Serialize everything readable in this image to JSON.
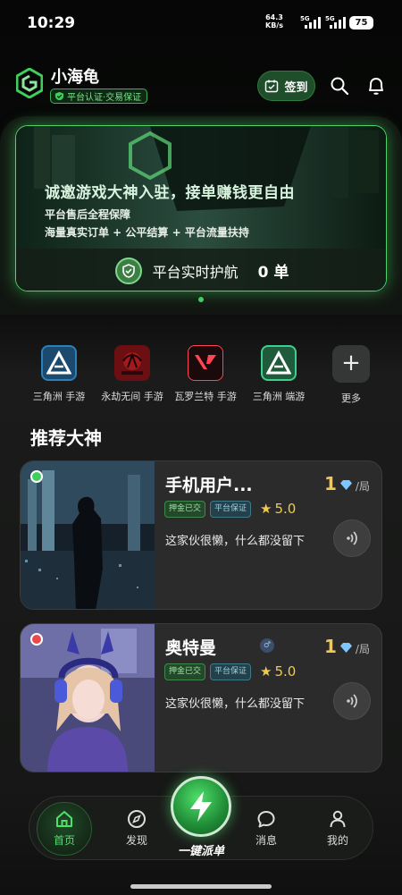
{
  "status_bar": {
    "time": "10:29",
    "net_speed": "64.3",
    "net_unit": "KB/s",
    "sig1": "5G",
    "sig2": "5G",
    "battery": "75"
  },
  "header": {
    "app_name": "小海龟",
    "cert_badge": "平台认证·交易保证",
    "checkin_label": "签到"
  },
  "banner": {
    "title": "诚邀游戏大神入驻，接单赚钱更自由",
    "sub1": "平台售后全程保障",
    "sub2": "海量真实订单 + 公平结算 + 平台流量扶持",
    "escort_label": "平台实时护航",
    "escort_count": "0 单"
  },
  "colors": {
    "accent": "#3fcf5c",
    "gold": "#f2c94c",
    "online": "#3fcf5c",
    "busy": "#e84a4a"
  },
  "games": [
    {
      "label": "三角洲 手游",
      "icon": "delta-icon"
    },
    {
      "label": "永劫无间 手游",
      "icon": "naraka-icon"
    },
    {
      "label": "瓦罗兰特 手游",
      "icon": "valorant-icon"
    },
    {
      "label": "三角洲 端游",
      "icon": "delta-pc-icon"
    },
    {
      "label": "更多",
      "icon": "plus-icon"
    }
  ],
  "section": {
    "title": "推荐大神"
  },
  "players": [
    {
      "name": "手机用户...",
      "price": "1",
      "unit": "/局",
      "tag_deposit": "押金已交",
      "tag_guarantee": "平台保证",
      "rating": "5.0",
      "bio": "这家伙很懒，什么都没留下",
      "status": "online"
    },
    {
      "name": "奥特曼",
      "price": "1",
      "unit": "/局",
      "tag_deposit": "押金已交",
      "tag_guarantee": "平台保证",
      "rating": "5.0",
      "bio": "这家伙很懒，什么都没留下",
      "status": "busy",
      "gender": "♂"
    }
  ],
  "nav": {
    "home": "首页",
    "discover": "发现",
    "dispatch": "一键派单",
    "messages": "消息",
    "mine": "我的"
  }
}
